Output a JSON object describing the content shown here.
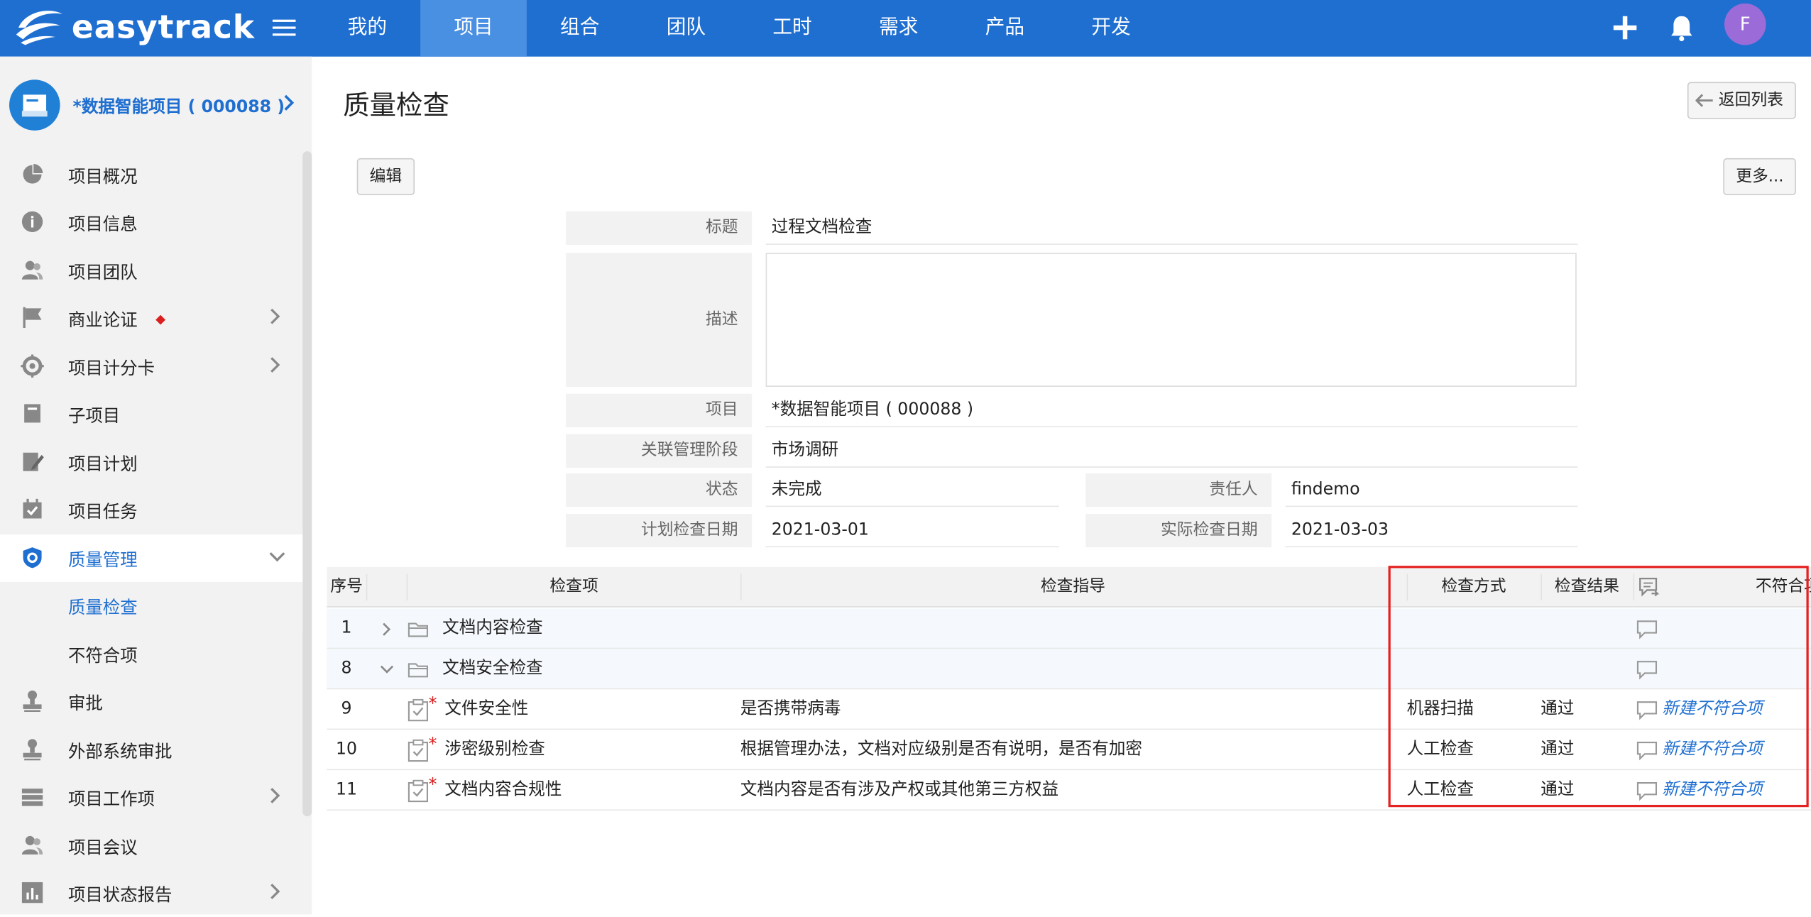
{
  "app": {
    "name": "easytrack"
  },
  "topnav": {
    "items": [
      {
        "label": "我的"
      },
      {
        "label": "项目"
      },
      {
        "label": "组合"
      },
      {
        "label": "团队"
      },
      {
        "label": "工时"
      },
      {
        "label": "需求"
      },
      {
        "label": "产品"
      },
      {
        "label": "开发"
      }
    ],
    "active_index": 1,
    "avatar_initial": "F",
    "colors": {
      "bar": "#1f6fd1",
      "active": "#4a90e2",
      "avatar": "#9b6bd8"
    }
  },
  "sidebar": {
    "project_name": "*数据智能项目 ( 000088 )",
    "items": [
      {
        "label": "项目概况",
        "icon": "pie-chart-icon"
      },
      {
        "label": "项目信息",
        "icon": "info-icon"
      },
      {
        "label": "项目团队",
        "icon": "team-icon"
      },
      {
        "label": "商业论证",
        "icon": "flag-icon"
      },
      {
        "label": "项目计分卡",
        "icon": "target-icon"
      },
      {
        "label": "子项目",
        "icon": "book-icon"
      },
      {
        "label": "项目计划",
        "icon": "edit-doc-icon"
      },
      {
        "label": "项目任务",
        "icon": "calendar-check-icon"
      },
      {
        "label": "质量管理",
        "icon": "shield-icon"
      },
      {
        "label": "质量检查"
      },
      {
        "label": "不符合项"
      },
      {
        "label": "审批",
        "icon": "stamp-icon"
      },
      {
        "label": "外部系统审批",
        "icon": "stamp-icon"
      },
      {
        "label": "项目工作项",
        "icon": "stack-icon"
      },
      {
        "label": "项目会议",
        "icon": "meeting-icon"
      },
      {
        "label": "项目状态报告",
        "icon": "bar-report-icon"
      }
    ]
  },
  "page": {
    "title": "质量检查",
    "back_button": "返回列表",
    "edit_button": "编辑",
    "more_button": "更多..."
  },
  "form": {
    "title_label": "标题",
    "title_value": "过程文档检查",
    "desc_label": "描述",
    "desc_value": "",
    "project_label": "项目",
    "project_value": "*数据智能项目 ( 000088 )",
    "phase_label": "关联管理阶段",
    "phase_value": "市场调研",
    "status_label": "状态",
    "status_value": "未完成",
    "owner_label": "责任人",
    "owner_value": "findemo",
    "plan_date_label": "计划检查日期",
    "plan_date_value": "2021-03-01",
    "actual_date_label": "实际检查日期",
    "actual_date_value": "2021-03-03"
  },
  "table": {
    "headers": {
      "seq": "序号",
      "item": "检查项",
      "guide": "检查指导",
      "method": "检查方式",
      "result": "检查结果",
      "nonconform": "不符合项"
    },
    "rows": [
      {
        "seq": "1",
        "type": "group",
        "expanded": false,
        "item": "文档内容检查",
        "guide": "",
        "method": "",
        "result": "",
        "link": ""
      },
      {
        "seq": "8",
        "type": "group",
        "expanded": true,
        "item": "文档安全检查",
        "guide": "",
        "method": "",
        "result": "",
        "link": ""
      },
      {
        "seq": "9",
        "type": "item",
        "item": "文件安全性",
        "guide": "是否携带病毒",
        "method": "机器扫描",
        "result": "通过",
        "link": "新建不符合项"
      },
      {
        "seq": "10",
        "type": "item",
        "item": "涉密级别检查",
        "guide": "根据管理办法，文档对应级别是否有说明，是否有加密",
        "method": "人工检查",
        "result": "通过",
        "link": "新建不符合项"
      },
      {
        "seq": "11",
        "type": "item",
        "item": "文档内容合规性",
        "guide": "文档内容是否有涉及产权或其他第三方权益",
        "method": "人工检查",
        "result": "通过",
        "link": "新建不符合项"
      }
    ]
  }
}
